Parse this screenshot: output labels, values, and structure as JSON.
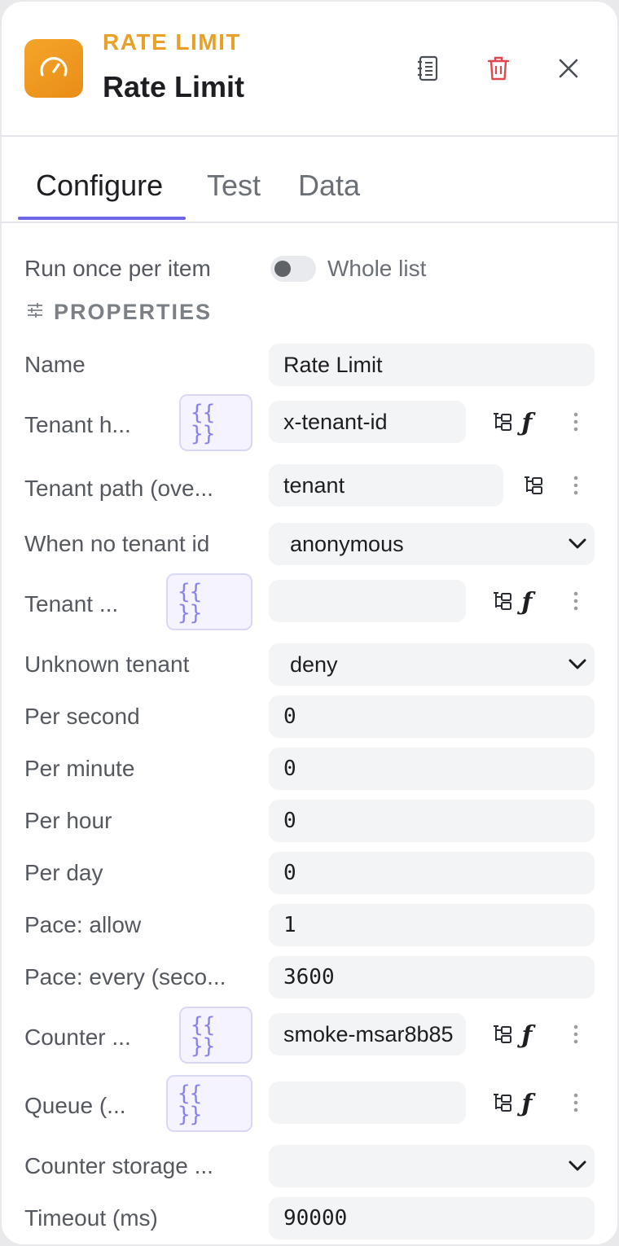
{
  "header": {
    "node_type": "RATE LIMIT",
    "title": "Rate Limit",
    "icons": {
      "node": "speedometer-icon",
      "notes": "notes-icon",
      "delete": "trash-icon",
      "close": "close-icon"
    },
    "colors": {
      "accent": "#e8a026",
      "danger": "#e0474c",
      "tab_active": "#6f63e6"
    }
  },
  "tabs": [
    {
      "label": "Configure",
      "active": true
    },
    {
      "label": "Test",
      "active": false
    },
    {
      "label": "Data",
      "active": false
    }
  ],
  "run_mode": {
    "label": "Run once per item",
    "toggle_label": "Whole list",
    "toggle_on": false
  },
  "properties": {
    "heading": "PROPERTIES",
    "expr_glyph_top": "{{",
    "expr_glyph_bottom": "}}",
    "fields": {
      "name": {
        "label": "Name",
        "value": "Rate Limit"
      },
      "tenant_header": {
        "label": "Tenant h...",
        "value": "x-tenant-id"
      },
      "tenant_path": {
        "label": "Tenant path (ove...",
        "value": "tenant"
      },
      "no_tenant": {
        "label": "When no tenant id",
        "value": "anonymous"
      },
      "tenant_other": {
        "label": "Tenant ...",
        "value": ""
      },
      "unknown_tenant": {
        "label": "Unknown tenant",
        "value": "deny"
      },
      "per_second": {
        "label": "Per second",
        "value": "0"
      },
      "per_minute": {
        "label": "Per minute",
        "value": "0"
      },
      "per_hour": {
        "label": "Per hour",
        "value": "0"
      },
      "per_day": {
        "label": "Per day",
        "value": "0"
      },
      "pace_allow": {
        "label": "Pace: allow",
        "value": "1"
      },
      "pace_every": {
        "label": "Pace: every (seco...",
        "value": "3600"
      },
      "counter": {
        "label": "Counter ...",
        "value": "smoke-msar8b85"
      },
      "queue": {
        "label": "Queue (...",
        "value": ""
      },
      "counter_storage": {
        "label": "Counter storage ...",
        "value": ""
      },
      "timeout": {
        "label": "Timeout (ms)",
        "value": "90000"
      }
    }
  }
}
